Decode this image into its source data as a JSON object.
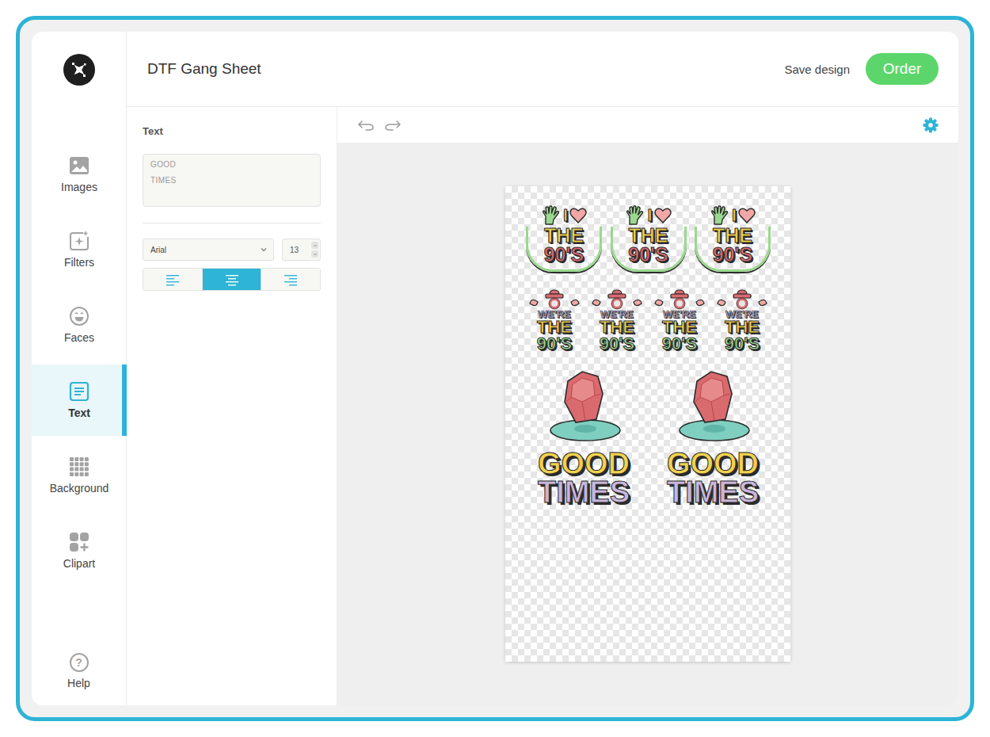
{
  "header": {
    "title": "DTF Gang Sheet",
    "save": "Save design",
    "order": "Order"
  },
  "sidebar": {
    "items": [
      {
        "label": "Images",
        "kind": "images",
        "selected": false
      },
      {
        "label": "Filters",
        "kind": "filters",
        "selected": false
      },
      {
        "label": "Faces",
        "kind": "faces",
        "selected": false
      },
      {
        "label": "Text",
        "kind": "text",
        "selected": true
      },
      {
        "label": "Background",
        "kind": "background",
        "selected": false
      },
      {
        "label": "Clipart",
        "kind": "clipart",
        "selected": false
      }
    ],
    "help": {
      "label": "Help",
      "glyph": "?"
    }
  },
  "text_panel": {
    "heading": "Text",
    "value": "GOOD\nTIMES",
    "font": "Arial",
    "size": "13",
    "align": [
      {
        "kind": "left",
        "selected": false
      },
      {
        "kind": "center",
        "selected": true
      },
      {
        "kind": "right",
        "selected": false
      }
    ]
  },
  "sheet": {
    "rows": [
      {
        "stickers": [
          {
            "kind": "love90s",
            "lines": [
              "I",
              "THE",
              "90'S"
            ]
          },
          {
            "kind": "love90s",
            "lines": [
              "I",
              "THE",
              "90'S"
            ]
          },
          {
            "kind": "love90s",
            "lines": [
              "I",
              "THE",
              "90'S"
            ]
          }
        ]
      },
      {
        "stickers": [
          {
            "kind": "were90s",
            "lines": [
              "WE'RE",
              "THE",
              "90'S"
            ]
          },
          {
            "kind": "were90s",
            "lines": [
              "WE'RE",
              "THE",
              "90'S"
            ]
          },
          {
            "kind": "were90s",
            "lines": [
              "WE'RE",
              "THE",
              "90'S"
            ]
          },
          {
            "kind": "were90s",
            "lines": [
              "WE'RE",
              "THE",
              "90'S"
            ]
          }
        ]
      },
      {
        "stickers": [
          {
            "kind": "goodtimes",
            "lines": [
              "GOOD",
              "TIMES"
            ]
          },
          {
            "kind": "goodtimes",
            "lines": [
              "GOOD",
              "TIMES"
            ]
          }
        ]
      }
    ]
  }
}
